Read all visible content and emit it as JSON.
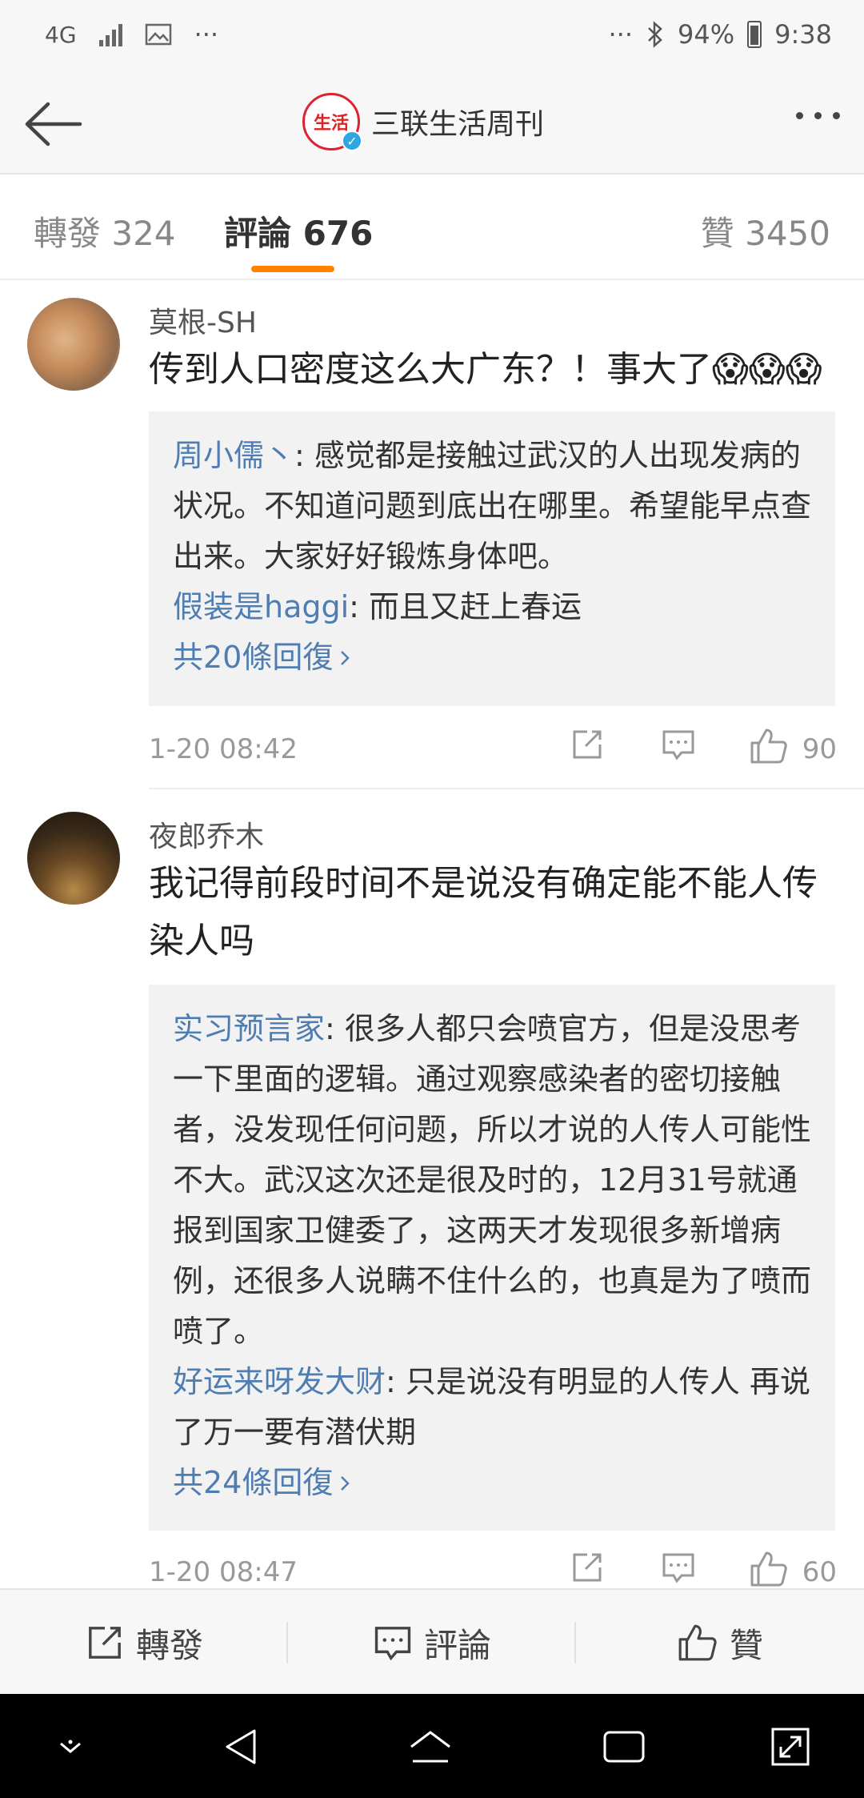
{
  "status": {
    "network": "4G",
    "battery": "94%",
    "time": "9:38",
    "dots_left": "···",
    "dots_right": "···"
  },
  "header": {
    "title": "三联生活周刊",
    "logo_text": "生活",
    "verified_icon": "verified-badge"
  },
  "tabs": {
    "forward": "轉發 324",
    "comments": "評論 676",
    "likes": "贊 3450"
  },
  "comments": [
    {
      "username": "莫根-SH",
      "text": "传到人口密度这么大广东？！事大了😱😱😱",
      "replies": [
        {
          "name": "周小儒丶",
          "text": ": 感觉都是接触过武汉的人出现发病的状况。不知道问题到底出在哪里。希望能早点查出来。大家好好锻炼身体吧。"
        },
        {
          "name": "假装是haggi",
          "text": ": 而且又赶上春运"
        }
      ],
      "more_replies": "共20條回復",
      "time": "1-20 08:42",
      "likes": "90"
    },
    {
      "username": "夜郎乔木",
      "text": "我记得前段时间不是说没有确定能不能人传染人吗",
      "replies": [
        {
          "name": "实习预言家",
          "text": ": 很多人都只会喷官方，但是没思考一下里面的逻辑。通过观察感染者的密切接触者，没发现任何问题，所以才说的人传人可能性不大。武汉这次还是很及时的，12月31号就通报到国家卫健委了，这两天才发现很多新增病例，还很多人说瞒不住什么的，也真是为了喷而喷了。"
        },
        {
          "name": "好运来呀发大财",
          "text": ": 只是说没有明显的人传人 再说了万一要有潜伏期"
        }
      ],
      "more_replies": "共24條回復",
      "time": "1-20 08:47",
      "likes": "60"
    }
  ],
  "actionbar": {
    "forward": "轉發",
    "comment": "評論",
    "like": "贊"
  }
}
